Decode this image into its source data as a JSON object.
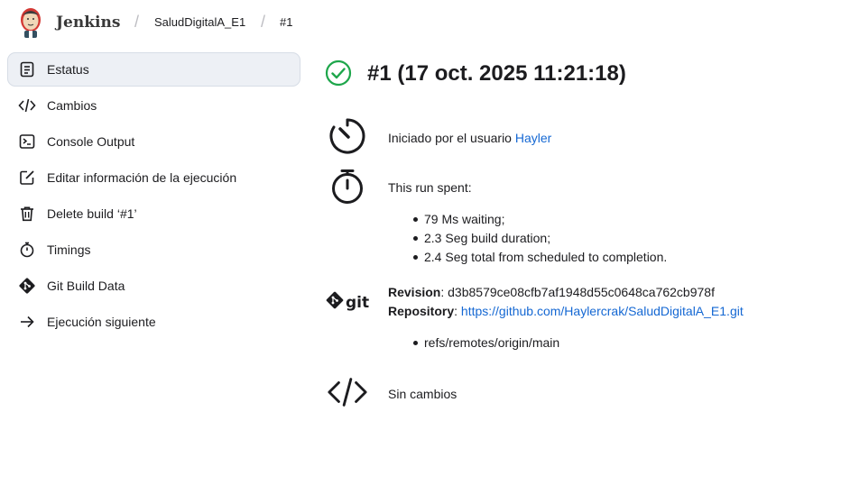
{
  "header": {
    "brand": "Jenkins",
    "breadcrumbs": [
      "SaludDigitalA_E1",
      "#1"
    ]
  },
  "sidebar": {
    "items": [
      {
        "label": "Estatus",
        "icon": "document-icon",
        "active": true
      },
      {
        "label": "Cambios",
        "icon": "code-icon"
      },
      {
        "label": "Console Output",
        "icon": "terminal-icon"
      },
      {
        "label": "Editar información de la ejecución",
        "icon": "edit-icon"
      },
      {
        "label": "Delete build ‘#1’",
        "icon": "trash-icon"
      },
      {
        "label": "Timings",
        "icon": "stopwatch-icon"
      },
      {
        "label": "Git Build Data",
        "icon": "git-icon"
      },
      {
        "label": "Ejecución siguiente",
        "icon": "arrow-right-icon"
      }
    ]
  },
  "build": {
    "title": "#1 (17 oct. 2025 11:21:18)",
    "status_icon": "success-check-icon",
    "started_prefix": "Iniciado por el usuario",
    "started_user": "Hayler",
    "run_spent_label": "This run spent:",
    "timings": [
      "79 Ms waiting;",
      "2.3 Seg build duration;",
      "2.4 Seg total from scheduled to completion."
    ],
    "revision_label": "Revision",
    "revision_value": "d3b8579ce08cfb7af1948d55c0648ca762cb978f",
    "repository_label": "Repository",
    "repository_url": "https://github.com/Haylercrak/SaludDigitalA_E1.git",
    "refs": [
      "refs/remotes/origin/main"
    ],
    "changes_text": "Sin cambios"
  },
  "colors": {
    "success": "#1ea64b",
    "link": "#1568d3",
    "active_bg": "#edf0f5"
  }
}
